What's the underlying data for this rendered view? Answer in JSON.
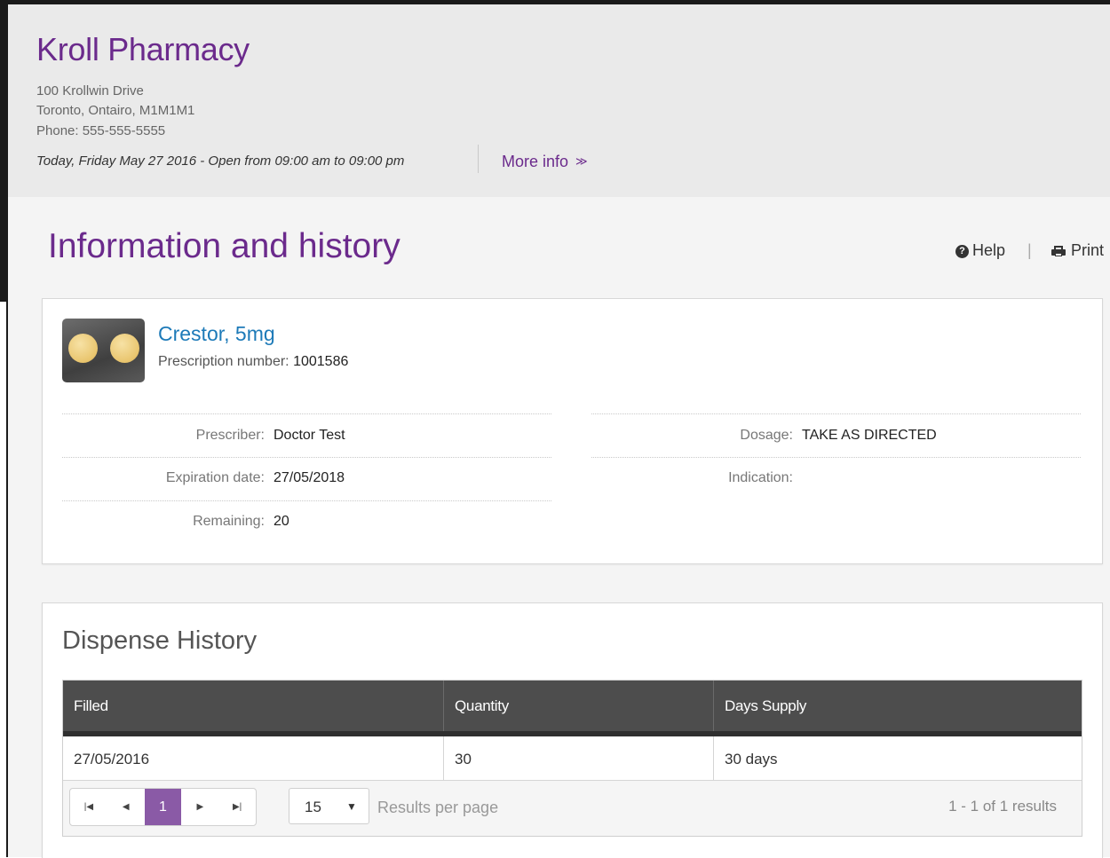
{
  "store": {
    "name": "Kroll Pharmacy",
    "address_line1": "100 Krollwin Drive",
    "address_line2": "Toronto, Ontairo, M1M1M1",
    "phone": "Phone: 555-555-5555",
    "hours": "Today, Friday May 27 2016 - Open from 09:00 am to 09:00 pm",
    "more_info": "More info",
    "more_info_icon": "double-chevron-down-icon"
  },
  "page": {
    "title": "Information and history",
    "help_label": "Help",
    "separator": "|",
    "print_label": "Print"
  },
  "prescription": {
    "drug_name": "Crestor, 5mg",
    "rx_label": "Prescription number:",
    "rx_number": "1001586",
    "fields_left": [
      {
        "label": "Prescriber:",
        "value": "Doctor Test"
      },
      {
        "label": "Expiration date:",
        "value": "27/05/2018"
      },
      {
        "label": "Remaining:",
        "value": "20"
      }
    ],
    "fields_right": [
      {
        "label": "Dosage:",
        "value": "TAKE AS DIRECTED"
      },
      {
        "label": "Indication:",
        "value": ""
      }
    ]
  },
  "dispense_history": {
    "title": "Dispense History",
    "columns": [
      "Filled",
      "Quantity",
      "Days Supply"
    ],
    "rows": [
      [
        "27/05/2016",
        "30",
        "30 days"
      ]
    ],
    "pager": {
      "first": "|◀",
      "prev": "◀",
      "current_page": "1",
      "next": "▶",
      "last": "▶|",
      "page_size": "15",
      "page_size_arrow": "▼",
      "per_page_label": "Results per page",
      "results_summary": "1 - 1 of 1 results"
    }
  },
  "colors": {
    "brand_purple": "#6b2a8c",
    "link_blue": "#1d7ab8",
    "table_header": "#4d4d4d",
    "active_page": "#8a5aa6"
  }
}
